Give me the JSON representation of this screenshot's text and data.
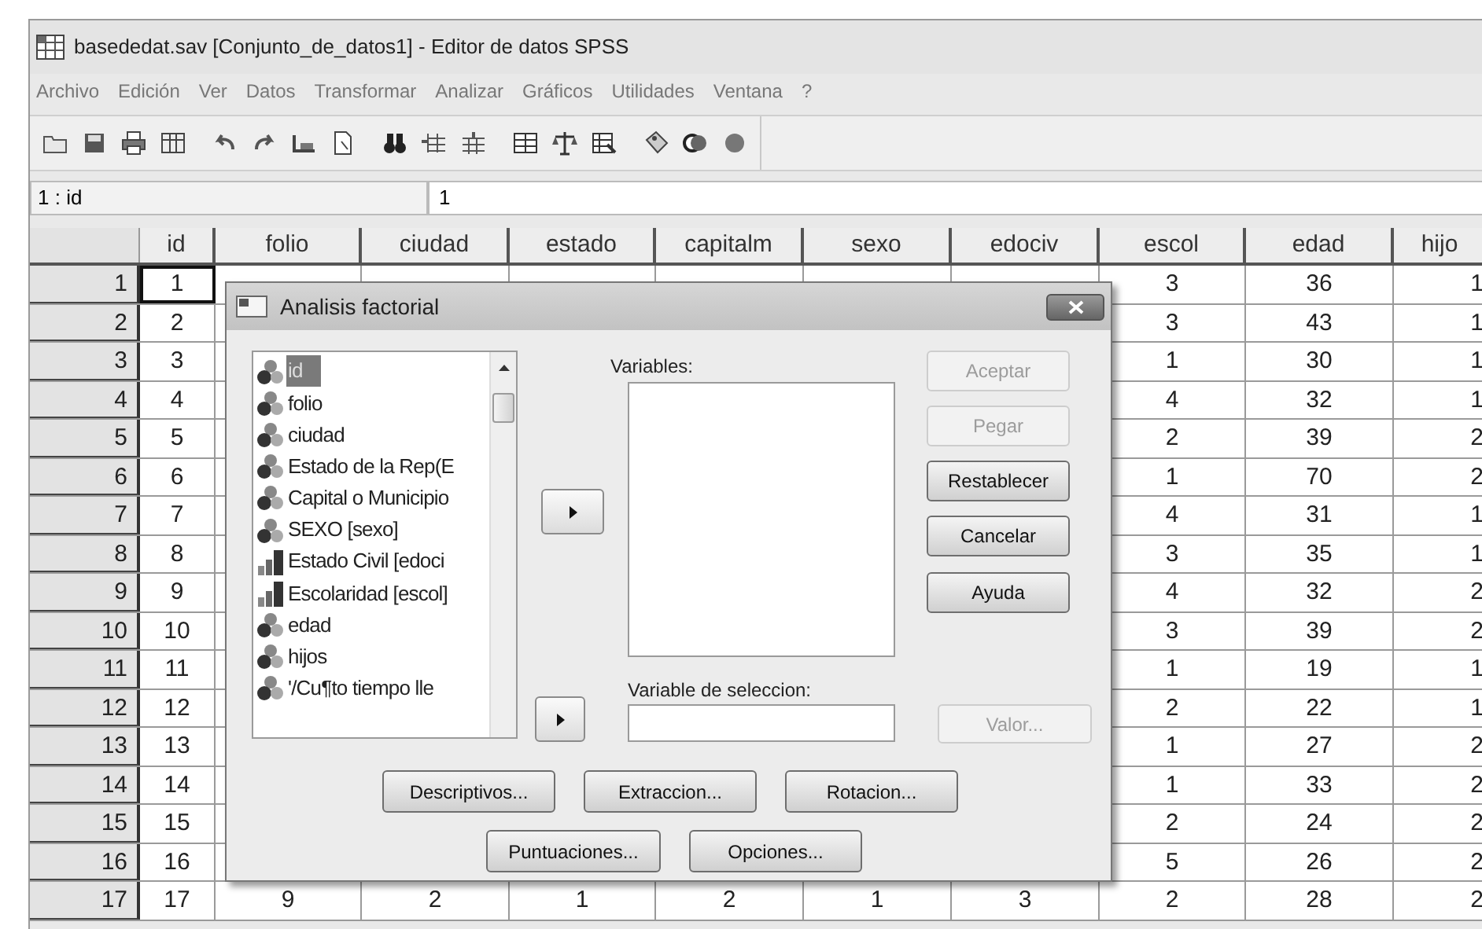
{
  "window": {
    "title": "basededat.sav [Conjunto_de_datos1] - Editor de datos SPSS"
  },
  "menu": [
    "Archivo",
    "Edición",
    "Ver",
    "Datos",
    "Transformar",
    "Analizar",
    "Gráficos",
    "Utilidades",
    "Ventana",
    "?"
  ],
  "cell_editor": {
    "reference": "1 : id",
    "value": "1"
  },
  "grid": {
    "columns": [
      "id",
      "folio",
      "ciudad",
      "estado",
      "capitalm",
      "sexo",
      "edociv",
      "escol",
      "edad",
      "hijo"
    ],
    "rows": [
      {
        "label": "1",
        "selected": true,
        "cells": [
          "1",
          null,
          null,
          null,
          null,
          null,
          null,
          "3",
          "36",
          "1"
        ]
      },
      {
        "label": "2",
        "selected": false,
        "cells": [
          "2",
          null,
          null,
          null,
          null,
          null,
          null,
          "3",
          "43",
          "1"
        ]
      },
      {
        "label": "3",
        "selected": false,
        "cells": [
          "3",
          null,
          null,
          null,
          null,
          null,
          null,
          "1",
          "30",
          "1"
        ]
      },
      {
        "label": "4",
        "selected": false,
        "cells": [
          "4",
          null,
          null,
          null,
          null,
          null,
          null,
          "4",
          "32",
          "1"
        ]
      },
      {
        "label": "5",
        "selected": false,
        "cells": [
          "5",
          null,
          null,
          null,
          null,
          null,
          null,
          "2",
          "39",
          "2"
        ]
      },
      {
        "label": "6",
        "selected": false,
        "cells": [
          "6",
          null,
          null,
          null,
          null,
          null,
          null,
          "1",
          "70",
          "2"
        ]
      },
      {
        "label": "7",
        "selected": false,
        "cells": [
          "7",
          null,
          null,
          null,
          null,
          null,
          null,
          "4",
          "31",
          "1"
        ]
      },
      {
        "label": "8",
        "selected": false,
        "cells": [
          "8",
          null,
          null,
          null,
          null,
          null,
          null,
          "3",
          "35",
          "1"
        ]
      },
      {
        "label": "9",
        "selected": false,
        "cells": [
          "9",
          null,
          null,
          null,
          null,
          null,
          null,
          "4",
          "32",
          "2"
        ]
      },
      {
        "label": "10",
        "selected": false,
        "cells": [
          "10",
          null,
          null,
          null,
          null,
          null,
          null,
          "3",
          "39",
          "2"
        ]
      },
      {
        "label": "11",
        "selected": false,
        "cells": [
          "11",
          null,
          null,
          null,
          null,
          null,
          null,
          "1",
          "19",
          "1"
        ]
      },
      {
        "label": "12",
        "selected": false,
        "cells": [
          "12",
          null,
          null,
          null,
          null,
          null,
          null,
          "2",
          "22",
          "1"
        ]
      },
      {
        "label": "13",
        "selected": false,
        "cells": [
          "13",
          null,
          null,
          null,
          null,
          null,
          null,
          "1",
          "27",
          "2"
        ]
      },
      {
        "label": "14",
        "selected": false,
        "cells": [
          "14",
          null,
          null,
          null,
          null,
          null,
          null,
          "1",
          "33",
          "2"
        ]
      },
      {
        "label": "15",
        "selected": false,
        "cells": [
          "15",
          null,
          null,
          null,
          null,
          null,
          null,
          "2",
          "24",
          "2"
        ]
      },
      {
        "label": "16",
        "selected": false,
        "cells": [
          "16",
          null,
          null,
          null,
          null,
          null,
          null,
          "5",
          "26",
          "2"
        ]
      },
      {
        "label": "17",
        "selected": false,
        "cells": [
          "17",
          "9",
          "2",
          "1",
          "2",
          "1",
          "3",
          "2",
          "28",
          "2"
        ]
      }
    ]
  },
  "dialog": {
    "title": "Analisis factorial",
    "source_list": [
      {
        "label": "id",
        "kind": "scale",
        "selected": true
      },
      {
        "label": "folio",
        "kind": "scale",
        "selected": false
      },
      {
        "label": "ciudad",
        "kind": "scale",
        "selected": false
      },
      {
        "label": "Estado de la Rep(E",
        "kind": "scale",
        "selected": false
      },
      {
        "label": "Capital o Municipio",
        "kind": "scale",
        "selected": false
      },
      {
        "label": "SEXO [sexo]",
        "kind": "scale",
        "selected": false
      },
      {
        "label": "Estado Civil [edoci",
        "kind": "ordinal",
        "selected": false
      },
      {
        "label": "Escolaridad [escol]",
        "kind": "ordinal",
        "selected": false
      },
      {
        "label": "edad",
        "kind": "scale",
        "selected": false
      },
      {
        "label": "hijos",
        "kind": "scale",
        "selected": false
      },
      {
        "label": "'/Cu¶to tiempo lle",
        "kind": "scale",
        "selected": false
      }
    ],
    "variables_label": "Variables:",
    "selection_label": "Variable de seleccion:",
    "side_buttons": [
      {
        "label": "Aceptar",
        "disabled": true
      },
      {
        "label": "Pegar",
        "disabled": true
      },
      {
        "label": "Restablecer",
        "disabled": false
      },
      {
        "label": "Cancelar",
        "disabled": false
      },
      {
        "label": "Ayuda",
        "disabled": false
      }
    ],
    "value_button": {
      "label": "Valor...",
      "disabled": true
    },
    "bottom_buttons": [
      {
        "label": "Descriptivos..."
      },
      {
        "label": "Extraccion..."
      },
      {
        "label": "Rotacion..."
      },
      {
        "label": "Puntuaciones..."
      },
      {
        "label": "Opciones..."
      }
    ]
  }
}
